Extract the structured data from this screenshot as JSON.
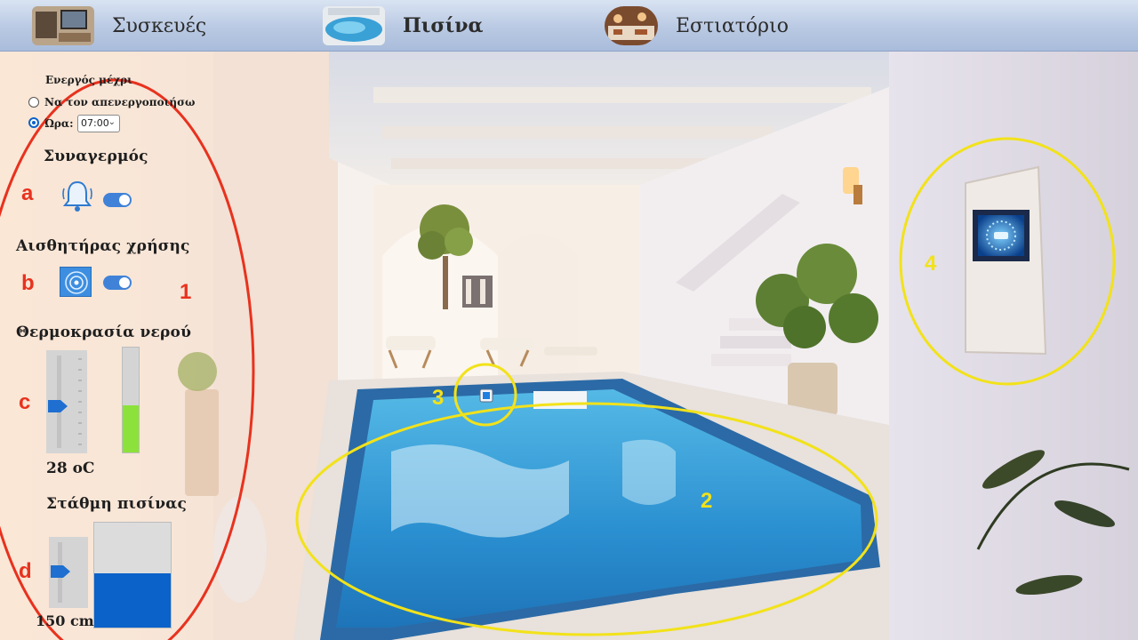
{
  "nav": {
    "items": [
      {
        "label": "Συσκευές",
        "active": false
      },
      {
        "label": "Πισίνα",
        "active": true
      },
      {
        "label": "Εστιατόριο",
        "active": false
      }
    ]
  },
  "panel": {
    "active_until": {
      "title": "Ενεργός μέχρι",
      "option_manual": "Να τον απενεργοποιήσω",
      "option_time": "Ώρα:",
      "selected": "time",
      "time_value": "07:00"
    },
    "alarm": {
      "title": "Συναγερμός",
      "enabled": true,
      "icon": "bell-icon"
    },
    "usage_sensor": {
      "title": "Αισθητήρας χρήσης",
      "enabled": true,
      "icon": "sensor-icon"
    },
    "water_temperature": {
      "title": "Θερμοκρασία νερού",
      "readout": "28 oC",
      "level_fraction": 0.45,
      "slider_fraction": 0.45
    },
    "pool_level": {
      "title": "Στάθμη πισίνας",
      "readout": "150 cm",
      "level_fraction": 0.52,
      "slider_fraction": 0.52
    }
  },
  "annotations": {
    "letters": [
      "a",
      "b",
      "c",
      "d"
    ],
    "numbers": [
      "1",
      "2",
      "3",
      "4"
    ]
  },
  "colors": {
    "red_marker": "#e8321e",
    "yellow_marker": "#f2e21a",
    "toggle_on": "#3f82d8",
    "temp_fill": "#8ce23a",
    "level_fill": "#0b62c9"
  }
}
